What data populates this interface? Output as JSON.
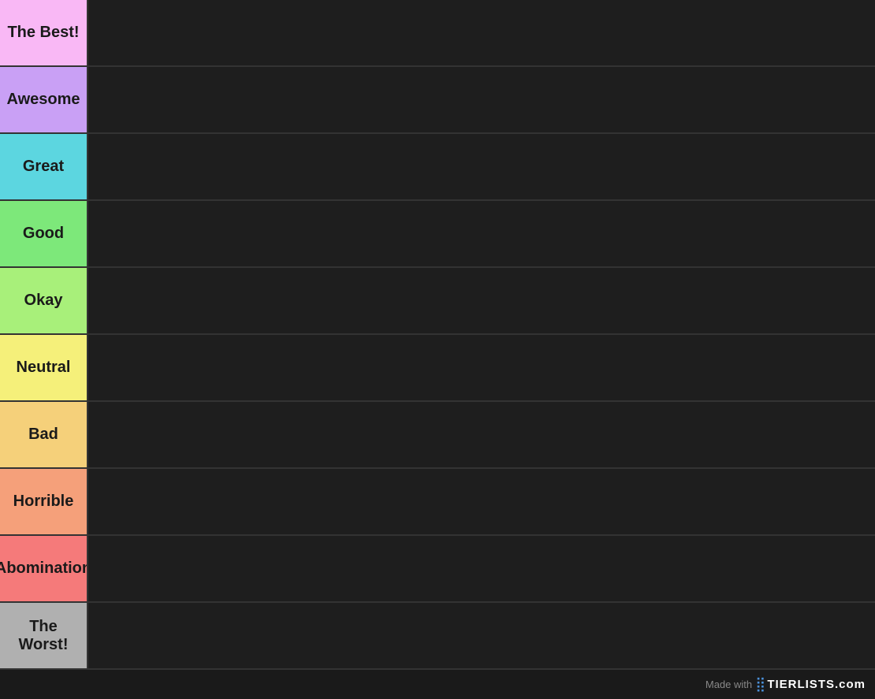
{
  "tiers": [
    {
      "id": "the-best",
      "label": "The Best!",
      "color": "#f9b8f5"
    },
    {
      "id": "awesome",
      "label": "Awesome",
      "color": "#c9a0f5"
    },
    {
      "id": "great",
      "label": "Great",
      "color": "#5cd6e0"
    },
    {
      "id": "good",
      "label": "Good",
      "color": "#7de87a"
    },
    {
      "id": "okay",
      "label": "Okay",
      "color": "#a8f07a"
    },
    {
      "id": "neutral",
      "label": "Neutral",
      "color": "#f5f07a"
    },
    {
      "id": "bad",
      "label": "Bad",
      "color": "#f5d07a"
    },
    {
      "id": "horrible",
      "label": "Horrible",
      "color": "#f5a07a"
    },
    {
      "id": "abomination",
      "label": "Abomination",
      "color": "#f57a7a"
    },
    {
      "id": "the-worst",
      "label": "The Worst!",
      "color": "#b0b0b0"
    }
  ],
  "watermark": {
    "made_with": "Made with",
    "brand": "TIERLISTS.com",
    "dot": "⠿"
  }
}
